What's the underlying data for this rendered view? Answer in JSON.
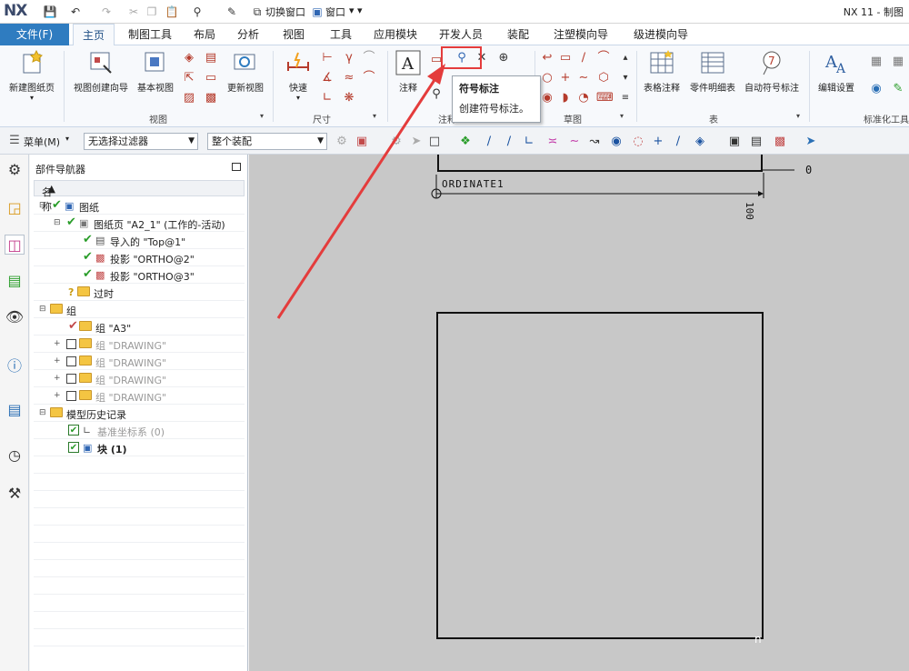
{
  "titlebar": {
    "logo": "NX",
    "switch_window": "切换窗口",
    "window_menu": "窗口",
    "window_title": "NX 11 - 制图"
  },
  "tabs": {
    "file": "文件(F)",
    "items": [
      "主页",
      "制图工具",
      "布局",
      "分析",
      "视图",
      "工具",
      "应用模块",
      "开发人员",
      "装配",
      "注塑模向导",
      "级进模向导"
    ],
    "active_index": 0
  },
  "ribbon": {
    "new_sheet": "新建图纸页",
    "view_wizard": "视图创建向导",
    "base_view": "基本视图",
    "update_view": "更新视图",
    "group_view": "视图",
    "quick": "快速",
    "group_dimension": "尺寸",
    "annotation": "注释",
    "group_annotation": "注释",
    "group_sketch": "草图",
    "table_note": "表格注释",
    "parts_list": "零件明细表",
    "auto_balloon": "自动符号标注",
    "group_table": "表",
    "edit_settings": "编辑设置",
    "group_standardize": "标准化工具"
  },
  "tooltip": {
    "title": "符号标注",
    "description": "创建符号标注。"
  },
  "selection_bar": {
    "menu": "菜单(M)",
    "filter": "无选择过滤器",
    "scope": "整个装配"
  },
  "navigator": {
    "title": "部件导航器",
    "column_name": "名称",
    "rows": [
      {
        "label": "图纸"
      },
      {
        "label": "图纸页 \"A2_1\" (工作的-活动)"
      },
      {
        "label": "导入的 \"Top@1\""
      },
      {
        "label": "投影 \"ORTHO@2\""
      },
      {
        "label": "投影 \"ORTHO@3\""
      },
      {
        "label": "过时"
      },
      {
        "label": "组"
      },
      {
        "label": "组 \"A3\""
      },
      {
        "label": "组 \"DRAWING\""
      },
      {
        "label": "组 \"DRAWING\""
      },
      {
        "label": "组 \"DRAWING\""
      },
      {
        "label": "组 \"DRAWING\""
      },
      {
        "label": "模型历史记录"
      },
      {
        "label": "基准坐标系 (0)"
      },
      {
        "label": "块 (1)"
      }
    ]
  },
  "canvas": {
    "ordinate_label": "ORDINATE1",
    "dim_zero": "0",
    "dim_value": "100",
    "watermark": "n"
  },
  "colors": {
    "accent": "#2f7cc0",
    "highlight": "#e43c3c",
    "canvas": "#c8c8c8"
  }
}
